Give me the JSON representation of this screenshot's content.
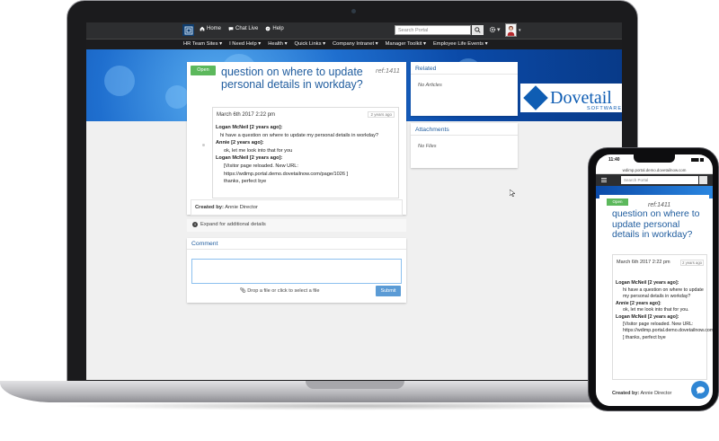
{
  "topbar": {
    "nav": [
      {
        "icon": "home-icon",
        "label": "Home"
      },
      {
        "icon": "chat-icon",
        "label": "Chat Live"
      },
      {
        "icon": "help-icon",
        "label": "Help"
      }
    ],
    "search_placeholder": "Search Portal"
  },
  "menubar": {
    "items": [
      "HR Team Sites ▾",
      "I Need Help ▾",
      "Health ▾",
      "Quick Links ▾",
      "Company Intranet ▾",
      "Manager Toolkit ▾",
      "Employee Life Events ▾"
    ]
  },
  "brand": {
    "name": "Dovetail",
    "sub": "SOFTWARE",
    "color": "#0f5db3"
  },
  "case": {
    "status": "Open",
    "title": "question on where to update personal details in workday?",
    "ref": "ref:1411",
    "date": "March 6th 2017 2:22 pm",
    "age": "2 years ago",
    "messages": [
      {
        "who": "Logan McNeil [2 years ago]:",
        "lines": [
          "hi have a question on where to update my personal details in workday?"
        ]
      },
      {
        "who": "Annie [2 years ago]:",
        "lines": [
          "ok, let me look into that for you"
        ]
      },
      {
        "who": "Logan McNeil [2 years ago]:",
        "lines": [
          "[Visitor page reloaded.  New URL: https://wdimp.portal.demo.dovetailnow.com/page/1026 ]",
          "thanks, perfect bye"
        ]
      }
    ],
    "created_label": "Created by:",
    "created_by": "Annie Director",
    "expand_text": "Expand for additional details"
  },
  "comment": {
    "heading": "Comment",
    "dropzone": "Drop a file or click to select a file",
    "submit": "Submit"
  },
  "related": {
    "heading": "Related",
    "empty": "No Articles"
  },
  "attachments": {
    "heading": "Attachments",
    "empty": "No Files"
  },
  "phone": {
    "time": "11:40",
    "url": "wdimp.portal.demo.dovetailnow.com",
    "search_placeholder": "Search Portal",
    "messages": [
      {
        "who": "Logan McNeil [2 years ago]:",
        "text": "hi have a question on where to update my personal details in workday?"
      },
      {
        "who": "Annie [2 years ago]:",
        "text": "ok, let me look into that for you."
      },
      {
        "who": "Logan McNeil [2 years ago]:",
        "text": "[Visitor page reloaded.  New URL: https://wdimp.portal.demo.dovetailnow.com/page/1026 ] thanks, perfect bye"
      }
    ]
  },
  "colors": {
    "accent": "#1f5c9e",
    "open_badge": "#5cb85c",
    "submit": "#5b9bd5",
    "topbar": "#2d2e30"
  }
}
